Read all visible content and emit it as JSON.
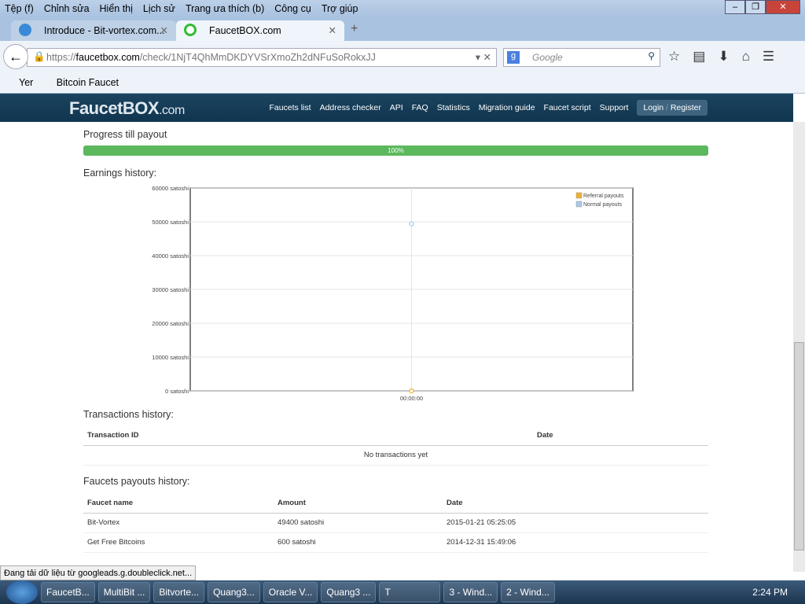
{
  "browser": {
    "menu": [
      "Tệp (f)",
      "Chỉnh sửa",
      "Hiển thị",
      "Lịch sử",
      "Trang ưa thích (b)",
      "Công cụ",
      "Trợ giúp"
    ],
    "tabs": [
      {
        "title": "Introduce - Bit-vortex.com..."
      },
      {
        "title": "FaucetBOX.com"
      }
    ],
    "url_prefix": "https://",
    "url_domain": "faucetbox.com",
    "url_path": "/check/1NjT4QhMmDKDYVSrXmoZh2dNFuSoRokxJJ",
    "search_placeholder": "Google",
    "bookmarks": [
      "Yer",
      "Bitcoin Faucet"
    ],
    "status": "Đang tải dữ liệu từ googleads.g.doubleclick.net..."
  },
  "site": {
    "logo": "FaucetBOX",
    "logo_suffix": ".com",
    "nav": [
      "Faucets list",
      "Address checker",
      "API",
      "FAQ",
      "Statistics",
      "Migration guide",
      "Faucet script",
      "Support"
    ],
    "login": "Login",
    "sep": "/",
    "register": "Register"
  },
  "progress": {
    "title": "Progress till payout",
    "percent": 100,
    "label": "100%"
  },
  "earnings_title": "Earnings history:",
  "chart_data": {
    "type": "line",
    "x": [
      "00:00:00"
    ],
    "series": [
      {
        "name": "Referral payouts",
        "values": [
          0
        ],
        "color": "#f0b030"
      },
      {
        "name": "Normal payouts",
        "values": [
          49400
        ],
        "color": "#a8c8e8"
      }
    ],
    "yticks": [
      "0 satoshi",
      "10000 satoshi",
      "20000 satoshi",
      "30000 satoshi",
      "40000 satoshi",
      "50000 satoshi",
      "60000 satoshi"
    ],
    "ylim": [
      0,
      60000
    ],
    "legend": "top-right"
  },
  "transactions": {
    "title": "Transactions history:",
    "headers": [
      "Transaction ID",
      "Date"
    ],
    "empty": "No transactions yet"
  },
  "payouts": {
    "title": "Faucets payouts history:",
    "headers": [
      "Faucet name",
      "Amount",
      "Date"
    ],
    "rows": [
      [
        "Bit-Vortex",
        "49400 satoshi",
        "2015-01-21 05:25:05"
      ],
      [
        "Get Free Bitcoins",
        "600 satoshi",
        "2014-12-31 15:49:06"
      ]
    ]
  },
  "taskbar": {
    "items": [
      "FaucetB...",
      "MultiBit ...",
      "Bitvorte...",
      "Quang3...",
      "Oracle V...",
      "Quang3 ...",
      "T",
      "3 - Wind...",
      "2 - Wind..."
    ],
    "clock": "2:24 PM"
  }
}
